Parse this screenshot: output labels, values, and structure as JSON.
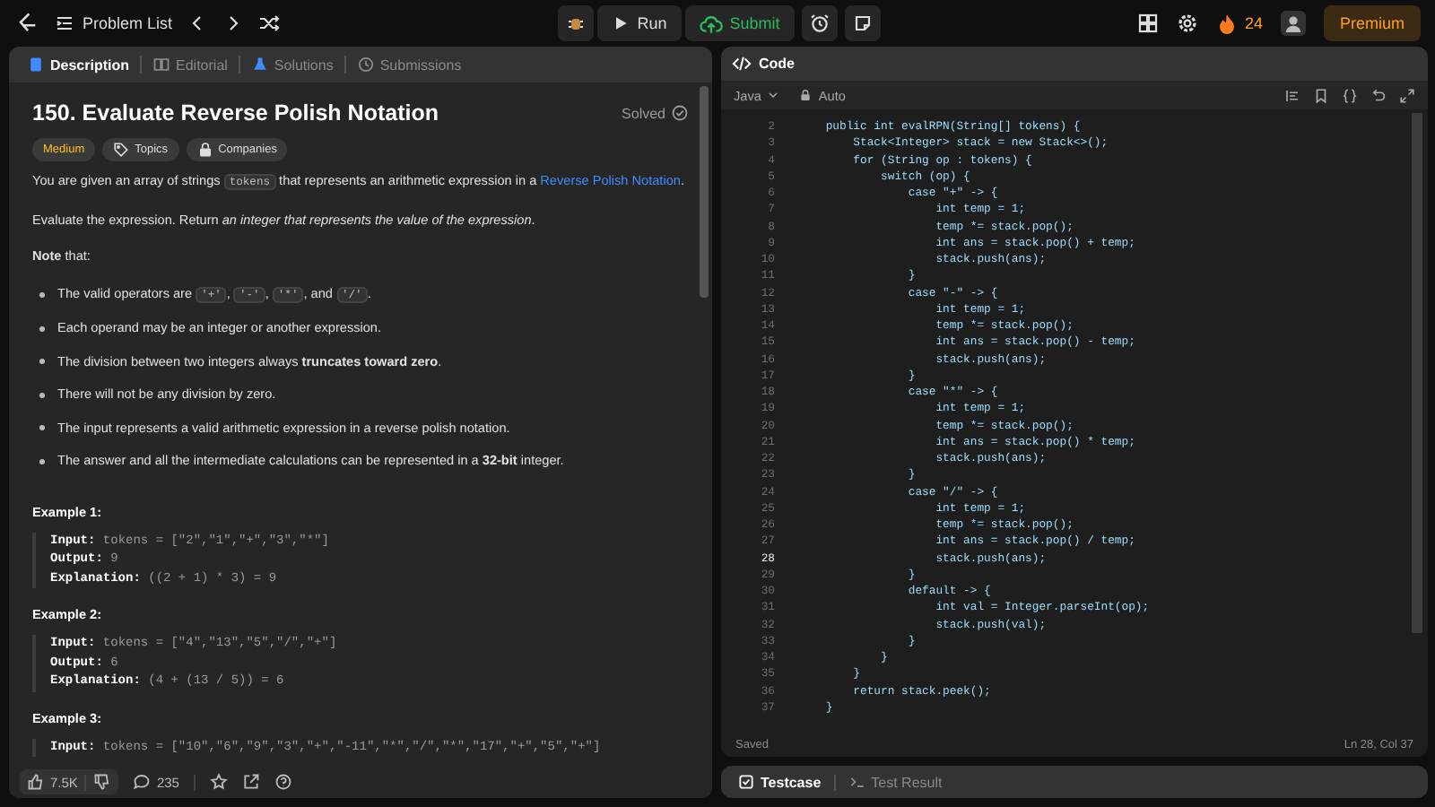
{
  "topbar": {
    "problem_list": "Problem List",
    "run": "Run",
    "submit": "Submit",
    "streak": "24",
    "premium": "Premium"
  },
  "description": {
    "tabs": [
      {
        "label": "Description",
        "selected": true
      },
      {
        "label": "Editorial",
        "selected": false
      },
      {
        "label": "Solutions",
        "selected": false
      },
      {
        "label": "Submissions",
        "selected": false
      }
    ],
    "title": "150. Evaluate Reverse Polish Notation",
    "status": "Solved",
    "difficulty": "Medium",
    "tags": [
      "Topics",
      "Companies"
    ],
    "paragraphs": [
      [
        {
          "kind": "text",
          "text": "You are given an array of strings "
        },
        {
          "kind": "code",
          "text": "tokens"
        },
        {
          "kind": "text",
          "text": " that represents an arithmetic expression in a "
        },
        {
          "kind": "link",
          "text": "Reverse Polish Notation"
        },
        {
          "kind": "text",
          "text": "."
        }
      ],
      [
        {
          "kind": "text",
          "text": "Evaluate the expression. Return *an integer that represents the value of the expression*."
        }
      ],
      [
        {
          "kind": "text",
          "text": "**Note** that:"
        }
      ]
    ],
    "bullets": [
      [
        {
          "kind": "text",
          "text": "The valid operators are "
        },
        {
          "kind": "code",
          "text": "'+'"
        },
        {
          "kind": "text",
          "text": ", "
        },
        {
          "kind": "code",
          "text": "'-'"
        },
        {
          "kind": "text",
          "text": ", "
        },
        {
          "kind": "code",
          "text": "'*'"
        },
        {
          "kind": "text",
          "text": ", and "
        },
        {
          "kind": "code",
          "text": "'/'"
        },
        {
          "kind": "text",
          "text": "."
        }
      ],
      [
        {
          "kind": "text",
          "text": "Each operand may be an integer or another expression."
        }
      ],
      [
        {
          "kind": "text",
          "text": "The division between two integers always **truncates toward zero**."
        }
      ],
      [
        {
          "kind": "text",
          "text": "There will not be any division by zero."
        }
      ],
      [
        {
          "kind": "text",
          "text": "The input represents a valid arithmetic expression in a reverse polish notation."
        }
      ],
      [
        {
          "kind": "text",
          "text": "The answer and all the intermediate calculations can be represented in a **32-bit** integer."
        }
      ]
    ],
    "examples": [
      {
        "title": "Example 1:",
        "lines": [
          {
            "label": "Input:",
            "value": "tokens = [\"2\",\"1\",\"+\",\"3\",\"*\"]"
          },
          {
            "label": "Output:",
            "value": "9"
          },
          {
            "label": "Explanation:",
            "value": "((2 + 1) * 3) = 9"
          }
        ]
      },
      {
        "title": "Example 2:",
        "lines": [
          {
            "label": "Input:",
            "value": "tokens = [\"4\",\"13\",\"5\",\"/\",\"+\"]"
          },
          {
            "label": "Output:",
            "value": "6"
          },
          {
            "label": "Explanation:",
            "value": "(4 + (13 / 5)) = 6"
          }
        ]
      },
      {
        "title": "Example 3:",
        "lines": [
          {
            "label": "Input:",
            "value": "tokens = [\"10\",\"6\",\"9\",\"3\",\"+\",\"-11\",\"*\",\"/\",\"*\",\"17\",\"+\",\"5\",\"+\"]"
          }
        ]
      }
    ],
    "footer": {
      "likes": "7.5K",
      "comments": "235"
    }
  },
  "editor": {
    "title": "Code",
    "language": "Java",
    "mode": "Auto",
    "status": "Saved",
    "cursor": "Ln 28, Col 37",
    "lines": [
      {
        "number": "2",
        "code": "    public int evalRPN(String[] tokens) {",
        "current": false
      },
      {
        "number": "3",
        "code": "        Stack<Integer> stack = new Stack<>();",
        "current": false
      },
      {
        "number": "4",
        "code": "        for (String op : tokens) {",
        "current": false
      },
      {
        "number": "5",
        "code": "            switch (op) {",
        "current": false
      },
      {
        "number": "6",
        "code": "                case \"+\" -> {",
        "current": false
      },
      {
        "number": "7",
        "code": "                    int temp = 1;",
        "current": false
      },
      {
        "number": "8",
        "code": "                    temp *= stack.pop();",
        "current": false
      },
      {
        "number": "9",
        "code": "                    int ans = stack.pop() + temp;",
        "current": false
      },
      {
        "number": "10",
        "code": "                    stack.push(ans);",
        "current": false
      },
      {
        "number": "11",
        "code": "                }",
        "current": false
      },
      {
        "number": "12",
        "code": "                case \"-\" -> {",
        "current": false
      },
      {
        "number": "13",
        "code": "                    int temp = 1;",
        "current": false
      },
      {
        "number": "14",
        "code": "                    temp *= stack.pop();",
        "current": false
      },
      {
        "number": "15",
        "code": "                    int ans = stack.pop() - temp;",
        "current": false
      },
      {
        "number": "16",
        "code": "                    stack.push(ans);",
        "current": false
      },
      {
        "number": "17",
        "code": "                }",
        "current": false
      },
      {
        "number": "18",
        "code": "                case \"*\" -> {",
        "current": false
      },
      {
        "number": "19",
        "code": "                    int temp = 1;",
        "current": false
      },
      {
        "number": "20",
        "code": "                    temp *= stack.pop();",
        "current": false
      },
      {
        "number": "21",
        "code": "                    int ans = stack.pop() * temp;",
        "current": false
      },
      {
        "number": "22",
        "code": "                    stack.push(ans);",
        "current": false
      },
      {
        "number": "23",
        "code": "                }",
        "current": false
      },
      {
        "number": "24",
        "code": "                case \"/\" -> {",
        "current": false
      },
      {
        "number": "25",
        "code": "                    int temp = 1;",
        "current": false
      },
      {
        "number": "26",
        "code": "                    temp *= stack.pop();",
        "current": false
      },
      {
        "number": "27",
        "code": "                    int ans = stack.pop() / temp;",
        "current": false
      },
      {
        "number": "28",
        "code": "                    stack.push(ans);",
        "current": true
      },
      {
        "number": "29",
        "code": "                }",
        "current": false
      },
      {
        "number": "30",
        "code": "                default -> {",
        "current": false
      },
      {
        "number": "31",
        "code": "                    int val = Integer.parseInt(op);",
        "current": false
      },
      {
        "number": "32",
        "code": "                    stack.push(val);",
        "current": false
      },
      {
        "number": "33",
        "code": "                }",
        "current": false
      },
      {
        "number": "34",
        "code": "            }",
        "current": false
      },
      {
        "number": "35",
        "code": "        }",
        "current": false
      },
      {
        "number": "36",
        "code": "        return stack.peek();",
        "current": false
      },
      {
        "number": "37",
        "code": "    }",
        "current": false
      }
    ]
  },
  "console": {
    "tabs": [
      {
        "label": "Testcase",
        "selected": true
      },
      {
        "label": "Test Result",
        "selected": false
      }
    ]
  }
}
